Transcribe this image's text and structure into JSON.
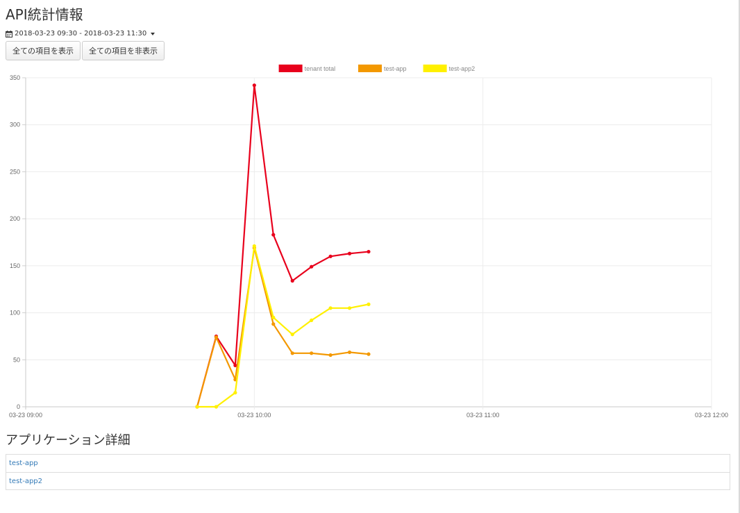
{
  "header": {
    "title": "API統計情報"
  },
  "date_picker": {
    "icon": "calendar-icon",
    "label": "2018-03-23 09:30 - 2018-03-23 11:30"
  },
  "buttons": {
    "show_all": "全ての項目を表示",
    "hide_all": "全ての項目を非表示"
  },
  "chart_data": {
    "type": "line",
    "x": [
      "09:45",
      "09:50",
      "09:55",
      "10:00",
      "10:05",
      "10:10",
      "10:15",
      "10:20",
      "10:25",
      "10:30"
    ],
    "x_ticks": [
      "03-23 09:00",
      "03-23 10:00",
      "03-23 11:00",
      "03-23 12:00"
    ],
    "x_range": [
      "09:00",
      "12:00"
    ],
    "y_ticks": [
      0,
      50,
      100,
      150,
      200,
      250,
      300,
      350
    ],
    "ylim": [
      0,
      350
    ],
    "grid": true,
    "legend_position": "top-center",
    "series": [
      {
        "name": "tenant total",
        "color": "#e8001c",
        "values": [
          0,
          75,
          44,
          342,
          183,
          134,
          149,
          160,
          163,
          165
        ]
      },
      {
        "name": "test-app",
        "color": "#f39800",
        "values": [
          0,
          74,
          29,
          169,
          88,
          57,
          57,
          55,
          58,
          56
        ]
      },
      {
        "name": "test-app2",
        "color": "#fff000",
        "values": [
          0,
          0,
          15,
          171,
          95,
          77,
          92,
          105,
          105,
          109
        ]
      }
    ]
  },
  "applications": {
    "title": "アプリケーション詳細",
    "items": [
      "test-app",
      "test-app2"
    ]
  }
}
